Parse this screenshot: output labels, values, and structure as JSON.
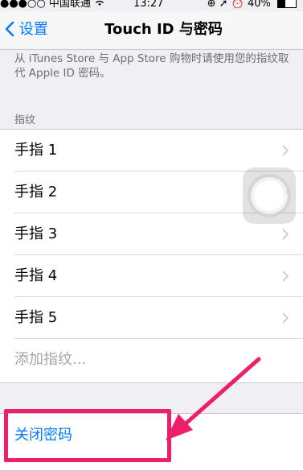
{
  "status_bar": {
    "signal": "●●●○○",
    "carrier": "中国联通",
    "wifi": "wifi-icon",
    "time": "13:27",
    "right_icons": "⊕ ➚ ⏰",
    "battery_percent": "40%",
    "battery_level": 0.4
  },
  "nav": {
    "back_label": "设置",
    "title": "Touch ID 与密码"
  },
  "description": "从 iTunes Store 与 App Store 购物时请使用您的指纹取代 Apple ID 密码。",
  "fingerprints": {
    "header": "指纹",
    "items": [
      {
        "label": "手指 1"
      },
      {
        "label": "手指 2"
      },
      {
        "label": "手指 3"
      },
      {
        "label": "手指 4"
      },
      {
        "label": "手指 5"
      }
    ],
    "add_label": "添加指纹..."
  },
  "passcode": {
    "turn_off_label": "关闭密码"
  },
  "colors": {
    "accent": "#007aff",
    "highlight": "#ee1f6a",
    "background": "#efeff4"
  }
}
